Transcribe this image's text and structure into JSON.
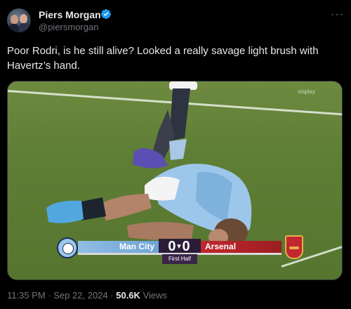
{
  "author": {
    "display_name": "Piers Morgan",
    "handle": "@piersmorgan",
    "verified": true,
    "avatar_icon": "profile-photo-icon"
  },
  "more_icon": "ellipsis-icon",
  "tweet": {
    "text": "Poor Rodri, is he still alive? Looked a really savage light brush with Havertz’s hand."
  },
  "media": {
    "watermark": "viaplay",
    "scoreboard": {
      "home_team": "Man City",
      "away_team": "Arsenal",
      "home_score": "0",
      "away_score": "0",
      "period": "First Half",
      "home_color": "#8fbde3",
      "away_color": "#c1272d"
    }
  },
  "meta": {
    "time": "11:35 PM",
    "date": "Sep 22, 2024",
    "separator": "·",
    "views_count": "50.6K",
    "views_label": "Views"
  }
}
